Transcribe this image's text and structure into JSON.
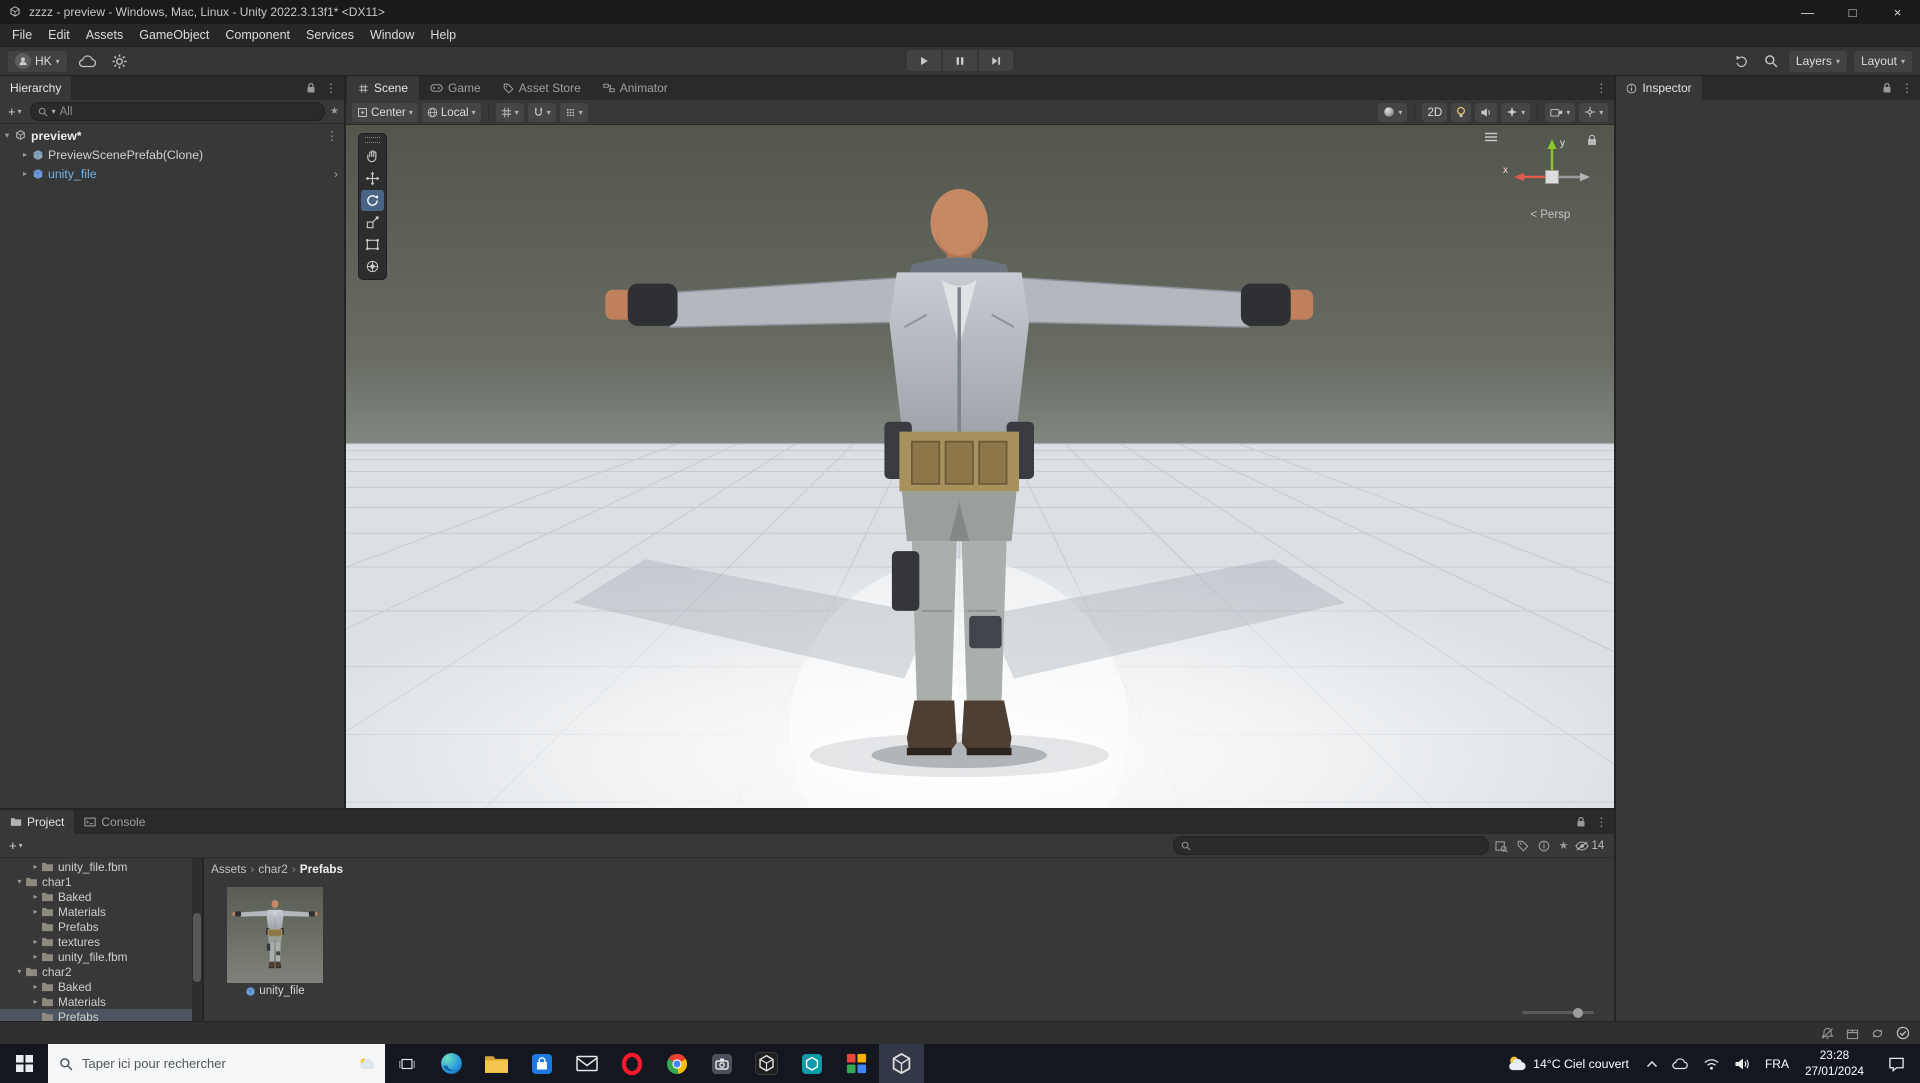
{
  "icons": {
    "kebab": "⋮",
    "caret": "▾",
    "chev_right": "›",
    "plus": "+",
    "minimize": "—",
    "maximize": "□",
    "close": "×",
    "back": "<",
    "star": "★"
  },
  "window": {
    "title": "zzzz - preview - Windows, Mac, Linux - Unity 2022.3.13f1* <DX11>"
  },
  "menubar": {
    "items": [
      "File",
      "Edit",
      "Assets",
      "GameObject",
      "Component",
      "Services",
      "Window",
      "Help"
    ]
  },
  "toolbar": {
    "account": "HK",
    "layers": "Layers",
    "layout": "Layout"
  },
  "hierarchy": {
    "title": "Hierarchy",
    "search_filter": "All",
    "rows": {
      "scene": "preview*",
      "prefab": "PreviewScenePrefab(Clone)",
      "model": "unity_file"
    }
  },
  "scene_view": {
    "tabs": {
      "scene": "Scene",
      "game": "Game",
      "asset_store": "Asset Store",
      "animator": "Animator"
    },
    "pivot": "Center",
    "orientation": "Local",
    "mode_2d": "2D",
    "persp": "Persp",
    "axis_x": "x",
    "axis_y": "y"
  },
  "inspector": {
    "title": "Inspector"
  },
  "project": {
    "tab_project": "Project",
    "tab_console": "Console",
    "hidden_count": "14",
    "breadcrumb": [
      {
        "label": "Assets"
      },
      {
        "label": "char2"
      },
      {
        "label": "Prefabs",
        "current": true
      }
    ],
    "tree": [
      {
        "label": "unity_file.fbm",
        "depth": 1,
        "arrow": "▸"
      },
      {
        "label": "char1",
        "depth": 0,
        "arrow": "▾"
      },
      {
        "label": "Baked",
        "depth": 1,
        "arrow": "▸"
      },
      {
        "label": "Materials",
        "depth": 1,
        "arrow": "▸"
      },
      {
        "label": "Prefabs",
        "depth": 1,
        "arrow": ""
      },
      {
        "label": "textures",
        "depth": 1,
        "arrow": "▸"
      },
      {
        "label": "unity_file.fbm",
        "depth": 1,
        "arrow": "▸"
      },
      {
        "label": "char2",
        "depth": 0,
        "arrow": "▾"
      },
      {
        "label": "Baked",
        "depth": 1,
        "arrow": "▸"
      },
      {
        "label": "Materials",
        "depth": 1,
        "arrow": "▸"
      },
      {
        "label": "Prefabs",
        "depth": 1,
        "arrow": "",
        "selected": true
      }
    ],
    "asset_label": "unity_file"
  },
  "taskbar": {
    "search_placeholder": "Taper ici pour rechercher",
    "weather": "14°C Ciel couvert",
    "language": "FRA",
    "time": "23:28",
    "date": "27/01/2024",
    "apps": [
      "edge",
      "file-explorer",
      "store",
      "mail",
      "opera",
      "chrome",
      "screenshot-tool",
      "unity-hub",
      "unity-teal",
      "colors-app",
      "unity-editor"
    ]
  }
}
